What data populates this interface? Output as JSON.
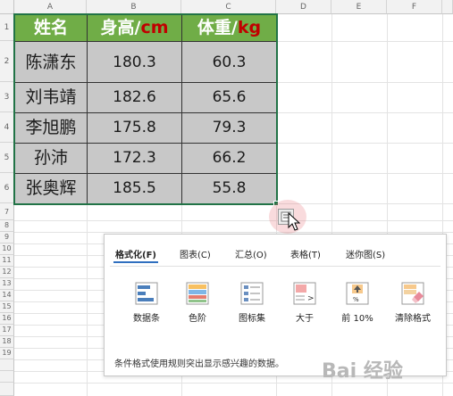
{
  "columns": [
    "A",
    "B",
    "C",
    "D",
    "E",
    "F"
  ],
  "rows": [
    "1",
    "2",
    "3",
    "4",
    "5",
    "6",
    "7",
    "8",
    "9",
    "10",
    "11",
    "12",
    "13",
    "14",
    "15",
    "16",
    "17",
    "18",
    "19"
  ],
  "table": {
    "headers": [
      {
        "text": "姓名",
        "unit": ""
      },
      {
        "text": "身高/",
        "unit": "cm"
      },
      {
        "text": "体重/",
        "unit": "kg"
      }
    ],
    "data": [
      [
        "陈潇东",
        "180.3",
        "60.3"
      ],
      [
        "刘韦靖",
        "182.6",
        "65.6"
      ],
      [
        "李旭鹏",
        "175.8",
        "79.3"
      ],
      [
        "孙沛",
        "172.3",
        "66.2"
      ],
      [
        "张奥辉",
        "185.5",
        "55.8"
      ]
    ]
  },
  "quick_analysis": {
    "tabs": [
      {
        "label": "格式化(F)",
        "active": true
      },
      {
        "label": "图表(C)",
        "active": false
      },
      {
        "label": "汇总(O)",
        "active": false
      },
      {
        "label": "表格(T)",
        "active": false
      },
      {
        "label": "迷你图(S)",
        "active": false
      }
    ],
    "items": [
      {
        "label": "数据条",
        "icon": "data-bars-icon"
      },
      {
        "label": "色阶",
        "icon": "color-scale-icon"
      },
      {
        "label": "图标集",
        "icon": "icon-set-icon"
      },
      {
        "label": "大于",
        "icon": "greater-than-icon"
      },
      {
        "label": "前 10%",
        "icon": "top-10-icon"
      },
      {
        "label": "清除格式",
        "icon": "clear-format-icon"
      }
    ],
    "description": "条件格式使用规则突出显示感兴趣的数据。"
  },
  "watermark_text": "Bai 经验",
  "colors": {
    "header_green": "#70ad47",
    "unit_red": "#c00000",
    "data_gray": "#c8c8c8",
    "tab_blue": "#2f6fbf"
  }
}
